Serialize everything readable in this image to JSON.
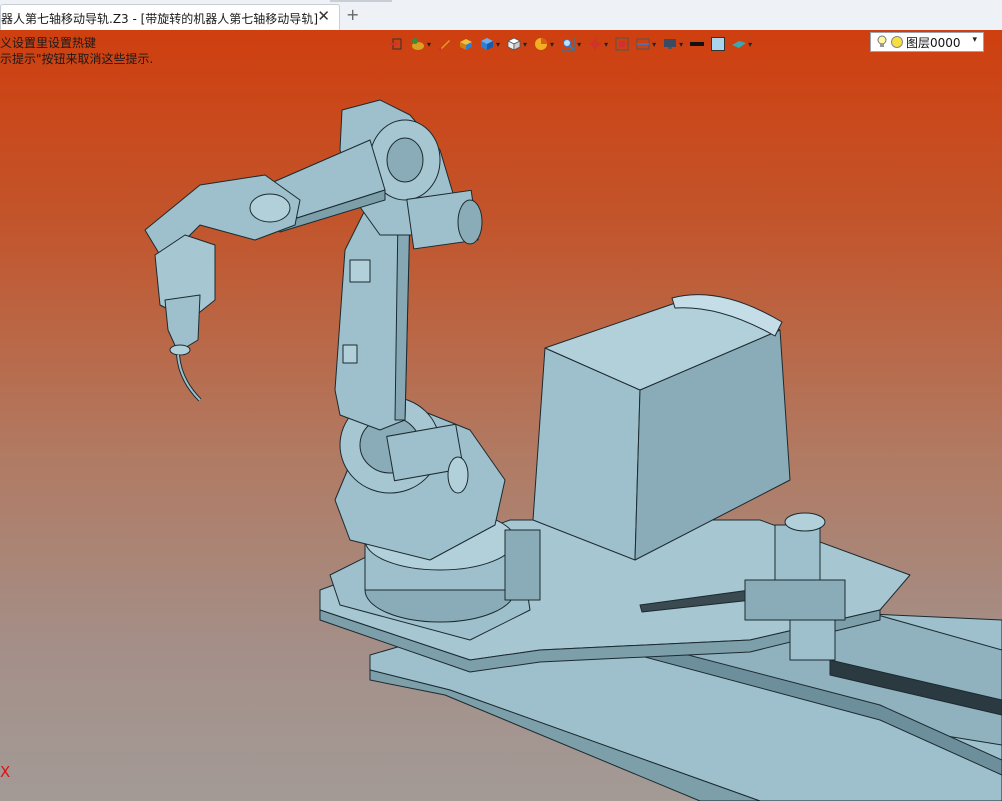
{
  "tabs": {
    "active_label": "器人第七轴移动导轨.Z3 - [带旋转的机器人第七轴移动导轨]",
    "close_glyph": "✕",
    "add_glyph": "+"
  },
  "viewport": {
    "hint_line1": "义设置里设置热键",
    "hint_line2": "示提示\"按钮来取消这些提示.",
    "axis_label": "X"
  },
  "toolbar": {
    "layer_label": "图层0000",
    "dropdown_glyph": "▾",
    "icons": [
      "exit-icon",
      "duck-icon",
      "pen-icon",
      "shaded-solid-icon",
      "cube-blue-icon",
      "cube-white-icon",
      "pie-icon",
      "zoom-icon",
      "rotate-icon",
      "fit-view-icon",
      "section-icon",
      "display-icon",
      "line-black-icon",
      "color-swatch-icon",
      "plane-icon",
      "bulb-icon",
      "layer-circle-icon"
    ],
    "colors": {
      "swatch": "#a9d4ec",
      "line": "#111111",
      "accent": "#2d7fd6"
    }
  },
  "model": {
    "fill": "#9ec0cc",
    "shade": "#86a8b5",
    "dark": "#6d8f9c",
    "edge": "#1b2a30"
  }
}
